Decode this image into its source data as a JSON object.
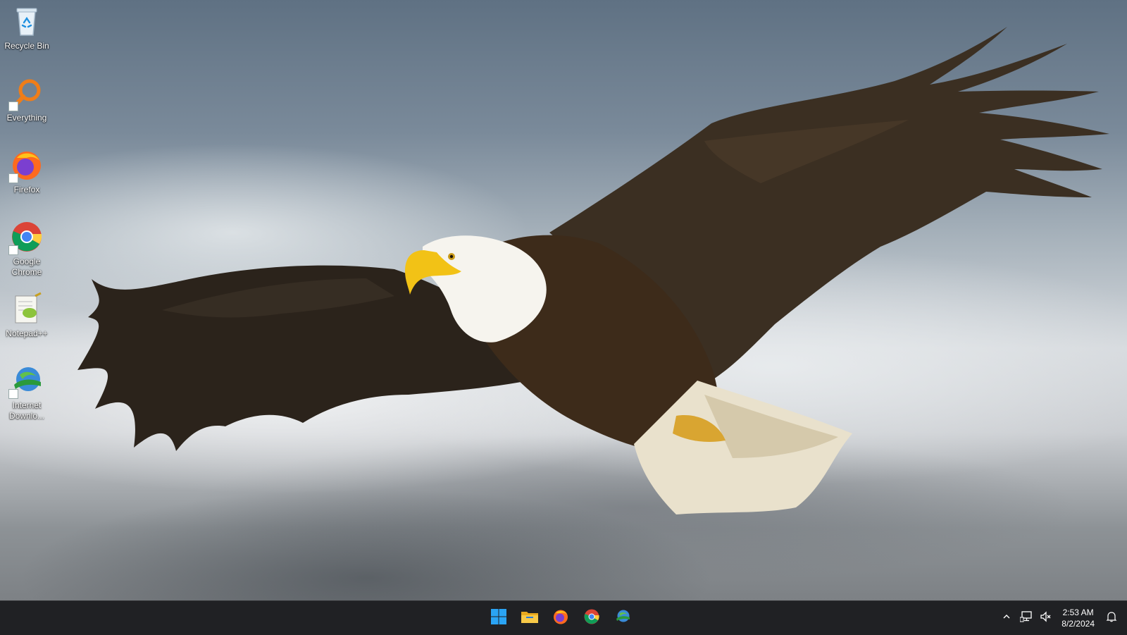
{
  "desktop": {
    "icons": [
      {
        "label": "Recycle Bin",
        "icon": "recycle-bin-icon"
      },
      {
        "label": "Everything",
        "icon": "everything-search-icon"
      },
      {
        "label": "Firefox",
        "icon": "firefox-icon"
      },
      {
        "label": "Google Chrome",
        "icon": "chrome-icon"
      },
      {
        "label": "Notepad++",
        "icon": "notepad-plus-plus-icon"
      },
      {
        "label": "Internet Downlo...",
        "icon": "internet-download-manager-icon"
      }
    ]
  },
  "taskbar": {
    "pinned": [
      {
        "icon": "windows-start-icon"
      },
      {
        "icon": "file-explorer-icon"
      },
      {
        "icon": "firefox-icon"
      },
      {
        "icon": "chrome-icon"
      },
      {
        "icon": "internet-download-manager-icon"
      }
    ],
    "tray": {
      "icons": [
        "chevron-up-icon",
        "network-icon",
        "volume-icon",
        "notification-bell-icon"
      ],
      "time": "2:53 AM",
      "date": "8/2/2024"
    }
  },
  "colors": {
    "taskbar_bg": "#202124",
    "desktop_text": "#ffffff",
    "windows_blue": "#2aa4f4"
  }
}
